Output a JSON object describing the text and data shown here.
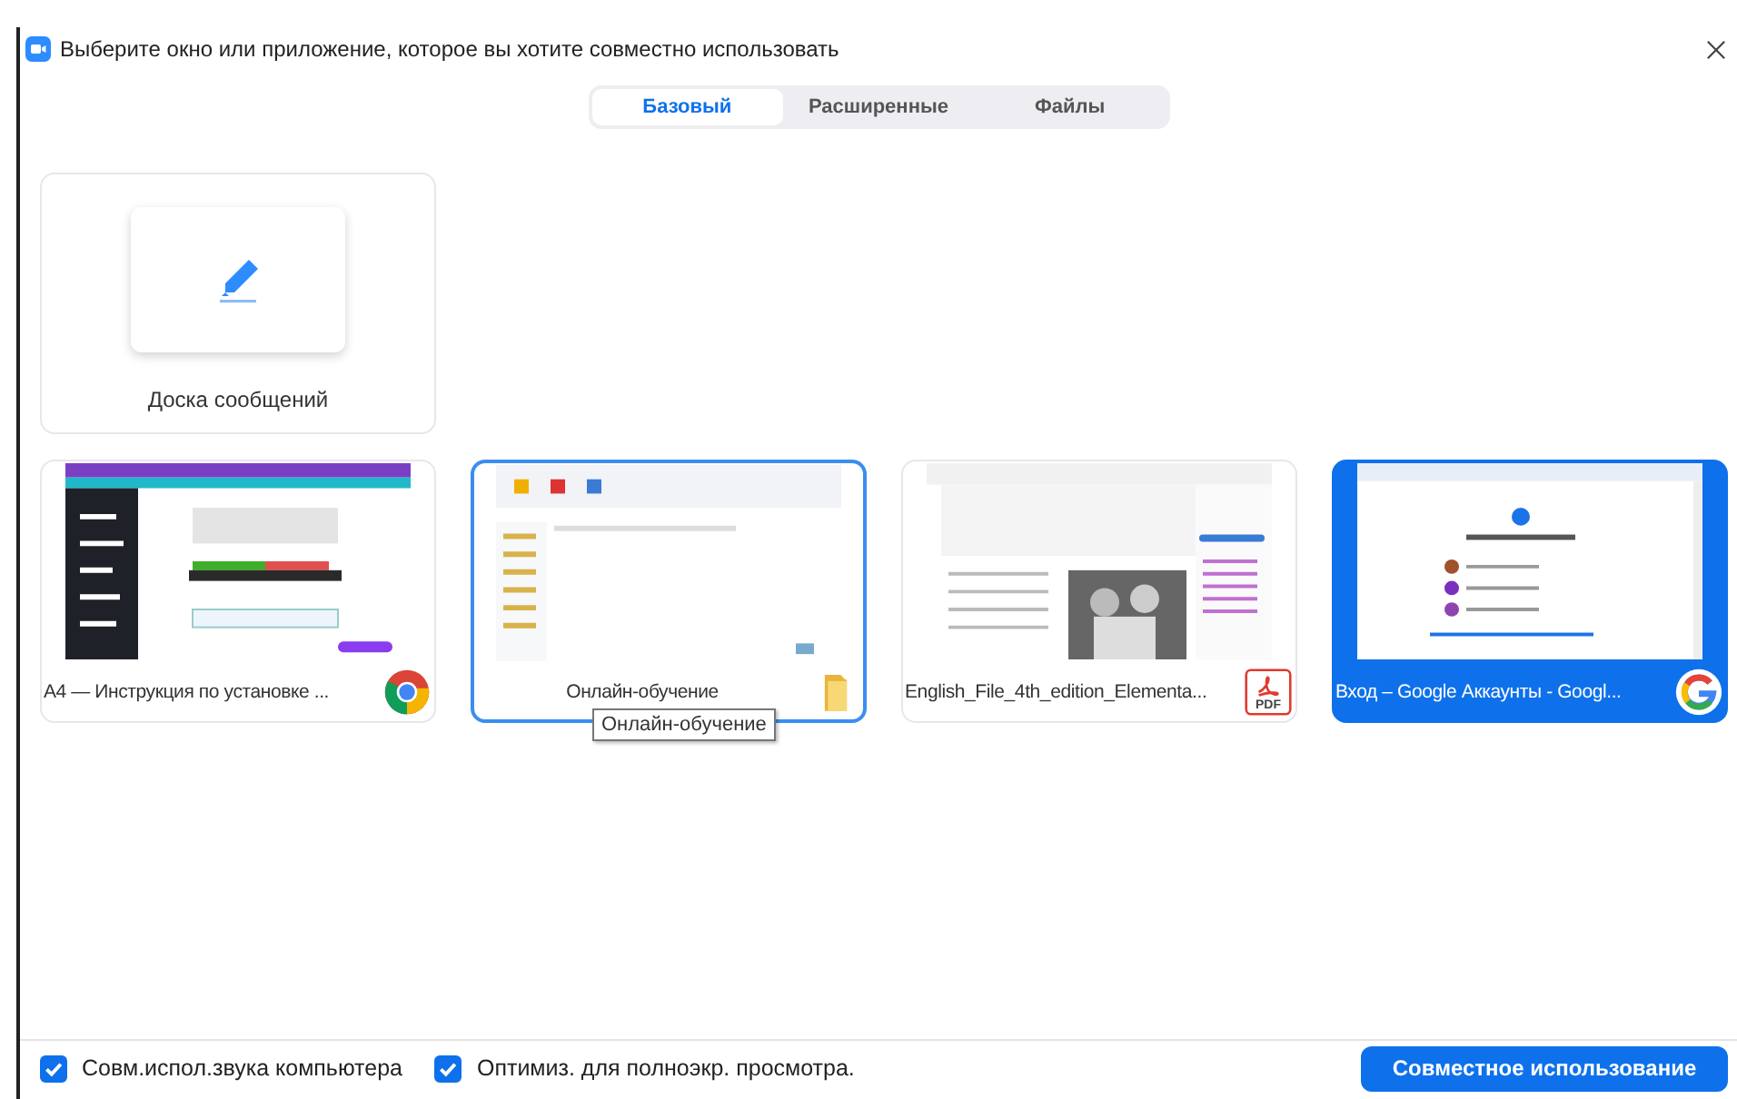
{
  "window": {
    "title": "Выберите окно или приложение, которое вы хотите совместно использовать"
  },
  "tabs": [
    {
      "label": "Базовый",
      "selected": true
    },
    {
      "label": "Расширенные",
      "selected": false
    },
    {
      "label": "Файлы",
      "selected": false
    }
  ],
  "whiteboard": {
    "label": "Доска сообщений"
  },
  "windows": [
    {
      "label": "A4 — Инструкция по установке ...",
      "kind": "chrome",
      "selected": false,
      "hovered": false
    },
    {
      "label": "Онлайн-обучение",
      "kind": "folder",
      "selected": false,
      "hovered": true,
      "tooltip": "Онлайн-обучение"
    },
    {
      "label": "English_File_4th_edition_Elementa...",
      "kind": "pdf",
      "app_label": "PDF",
      "selected": false,
      "hovered": false
    },
    {
      "label": "Вход – Google Аккаунты - Googl...",
      "kind": "google",
      "selected": true,
      "hovered": false
    }
  ],
  "options": [
    {
      "label": "Совм.испол.звука компьютера",
      "checked": true
    },
    {
      "label": "Оптимиз. для полноэкр. просмотра.",
      "checked": true
    }
  ],
  "share_button": "Совместное использование"
}
